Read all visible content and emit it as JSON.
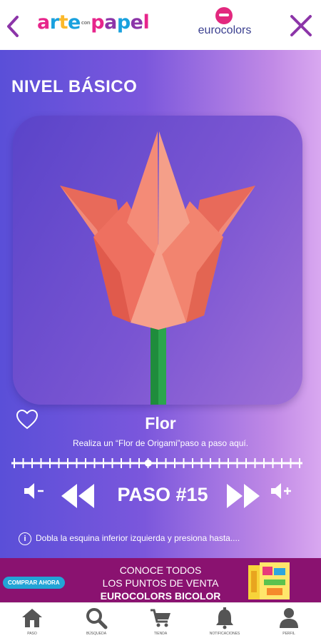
{
  "header": {
    "logo_text": "arte papel",
    "logo_small": "con",
    "brand": "eurocolors",
    "back_icon": "chevron-left-icon",
    "close_icon": "close-icon",
    "accent": "#8c35a8"
  },
  "lesson": {
    "level": "NIVEL BÁSICO",
    "title": "Flor",
    "subtitle": "Realiza un “Flor de Origami”paso a paso aquí.",
    "step_label": "PASO #15",
    "instruction": "Dobla la esquina inferior izquierda y presiona hasta....",
    "progress_fraction": 0.47
  },
  "controls": {
    "volume_down_icon": "volume-down-icon",
    "rewind_icon": "rewind-icon",
    "forward_icon": "fast-forward-icon",
    "volume_up_icon": "volume-up-icon",
    "favorite_icon": "heart-icon"
  },
  "banner": {
    "button": "COMPRAR AHORA",
    "line1": "CONOCE TODOS",
    "line2": "LOS PUNTOS DE VENTA",
    "line3": "EUROCOLORS BICOLOR"
  },
  "nav": {
    "items": [
      {
        "label": "PASO",
        "icon": "home-icon"
      },
      {
        "label": "BÚSQUEDA",
        "icon": "search-icon"
      },
      {
        "label": "TIENDA",
        "icon": "cart-icon"
      },
      {
        "label": "NOTIFICACIONES",
        "icon": "bell-icon"
      },
      {
        "label": "PERFIL",
        "icon": "user-icon"
      }
    ]
  }
}
